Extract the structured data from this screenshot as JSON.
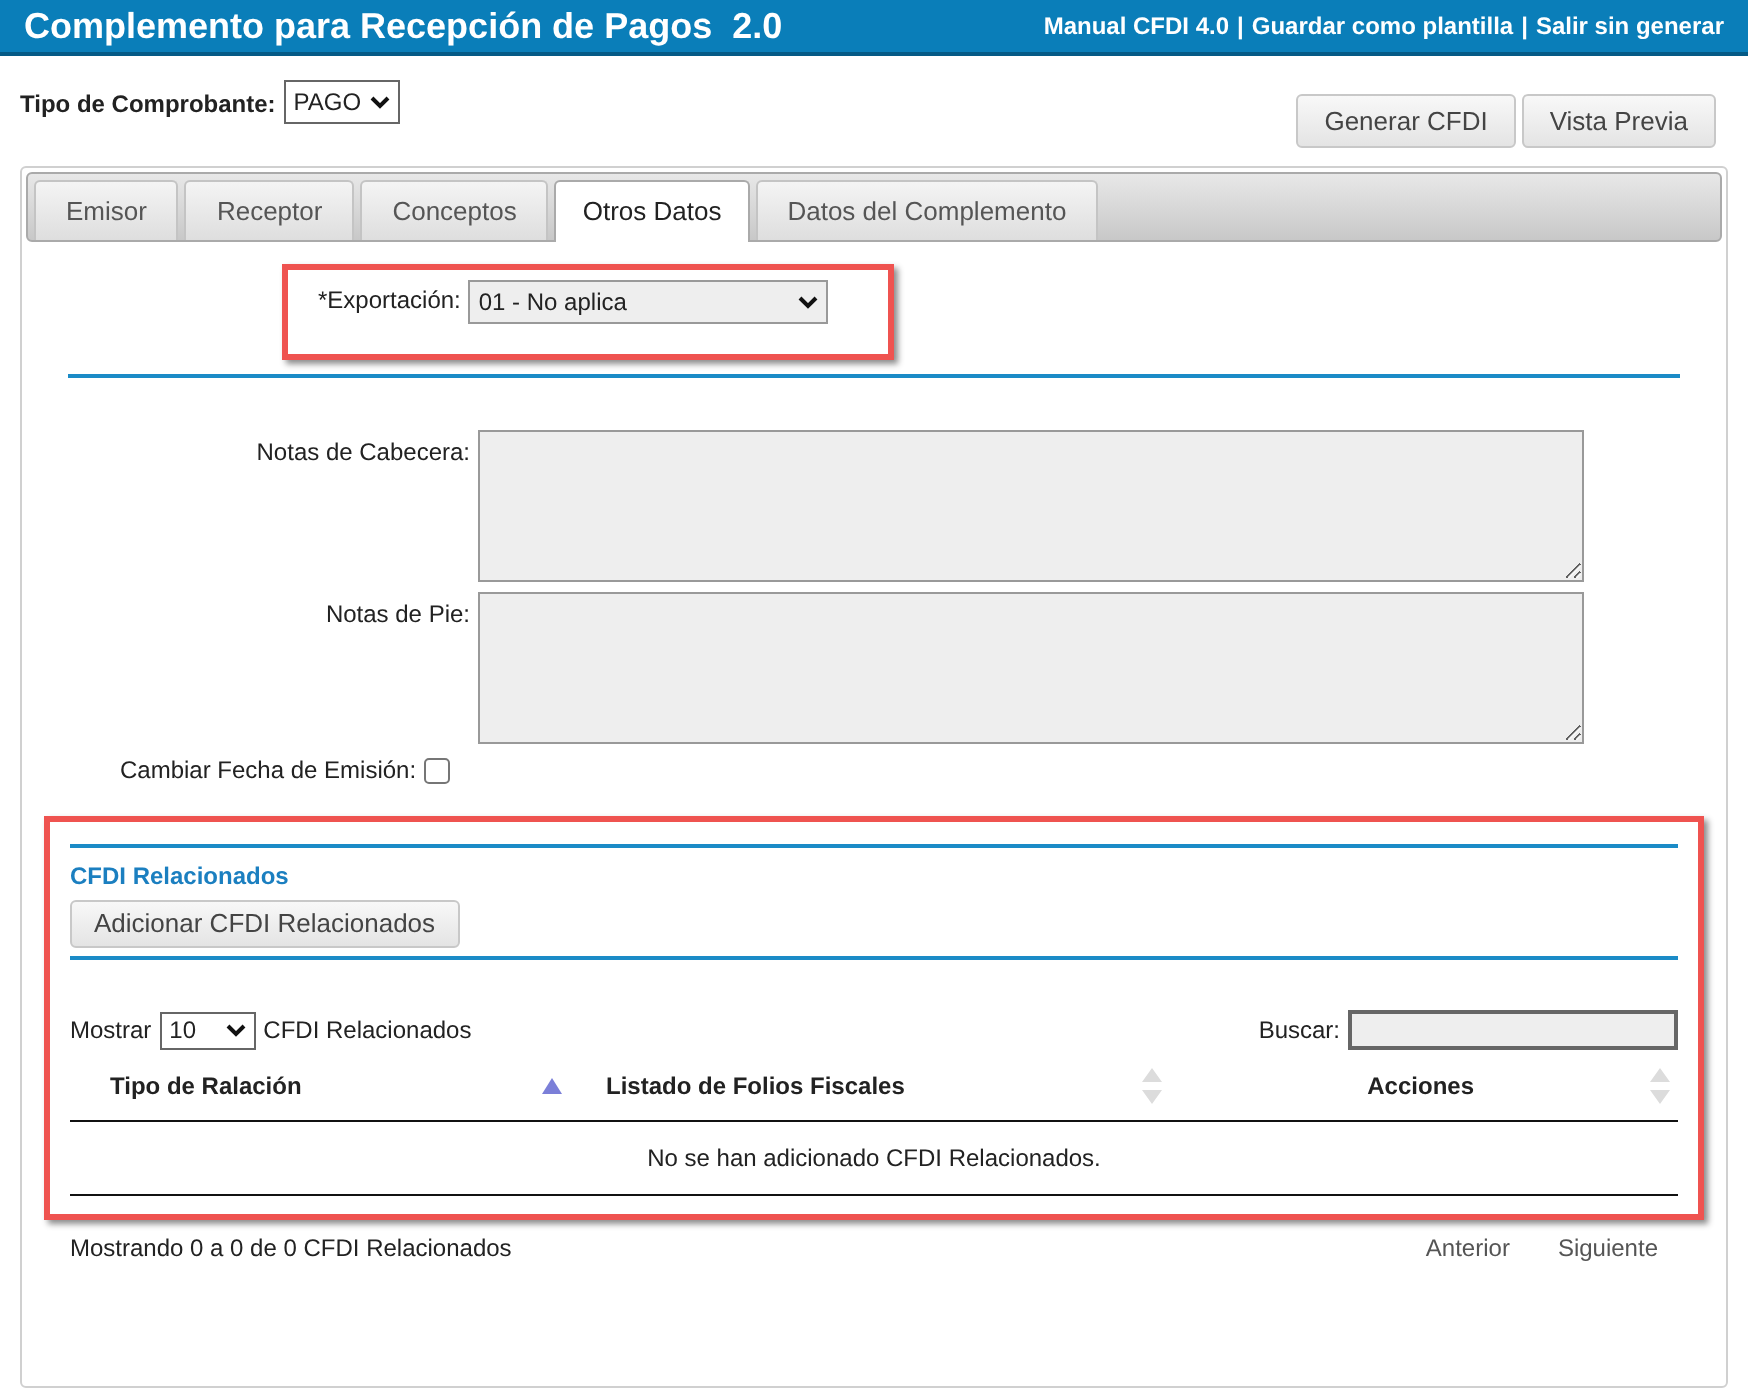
{
  "header": {
    "title": "Complemento para Recepción de Pagos  2.0",
    "links": [
      "Manual CFDI 4.0",
      "Guardar como plantilla",
      "Salir sin generar"
    ],
    "separator": "|"
  },
  "tipo_comprobante": {
    "label": "Tipo de Comprobante:",
    "value": "PAGO"
  },
  "buttons": [
    "Generar CFDI",
    "Vista Previa"
  ],
  "tabs": [
    {
      "label": "Emisor",
      "selected": false
    },
    {
      "label": "Receptor",
      "selected": false
    },
    {
      "label": "Conceptos",
      "selected": false
    },
    {
      "label": "Otros Datos",
      "selected": true
    },
    {
      "label": "Datos del Complemento",
      "selected": false
    }
  ],
  "exportacion": {
    "label": "*Exportación:",
    "value": "01 - No aplica"
  },
  "notas": [
    {
      "label": "Notas de Cabecera:"
    },
    {
      "label": "Notas de Pie:"
    }
  ],
  "cambiar_fecha": {
    "label": "Cambiar Fecha de Emisión:",
    "checked": false
  },
  "cfdi_relacionados": {
    "title": "CFDI Relacionados",
    "add_button": "Adicionar CFDI Relacionados",
    "show_label": "Mostrar",
    "page_size": "10",
    "show_suffix": "CFDI Relacionados",
    "search_label": "Buscar:",
    "columns": [
      {
        "label": "Tipo de Ralación",
        "sorted": true
      },
      {
        "label": "Listado de Folios Fiscales",
        "sorted": false
      },
      {
        "label": "Acciones",
        "sorted": false
      }
    ],
    "empty_message": "No se han adicionado CFDI Relacionados.",
    "info": "Mostrando 0 a 0 de 0 CFDI Relacionados",
    "pager": [
      "Anterior",
      "Siguiente"
    ]
  }
}
